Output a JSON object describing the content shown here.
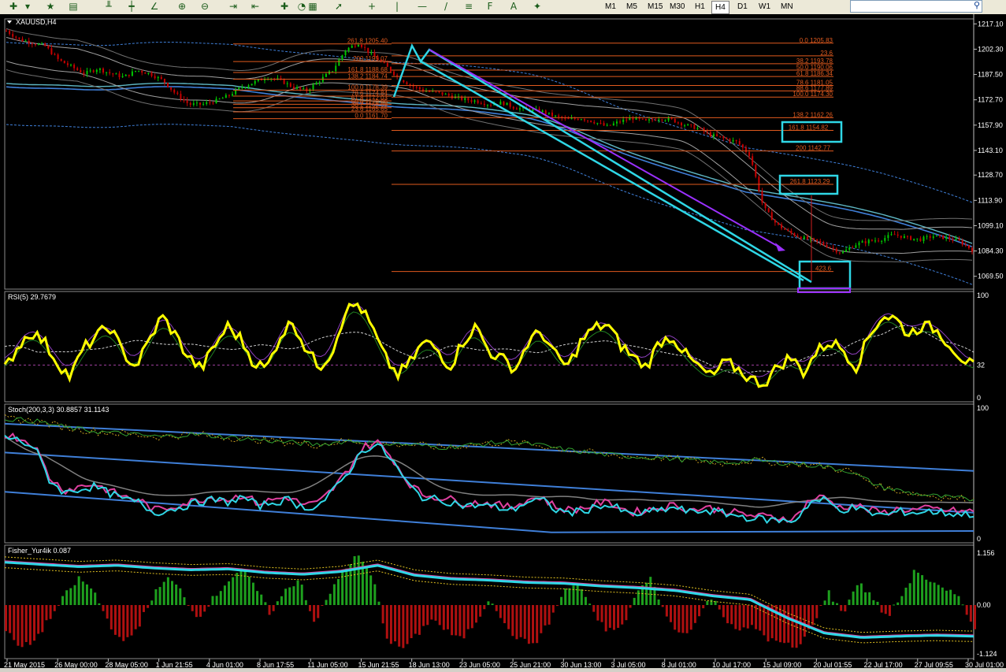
{
  "toolbar": {
    "timeframes": [
      "M1",
      "M5",
      "M15",
      "M30",
      "H1",
      "H4",
      "D1",
      "W1",
      "MN"
    ],
    "active_timeframe": "H4",
    "icons": [
      "new-chart-icon",
      "dropdown-icon",
      "favorites-star-icon",
      "profile-icon",
      "bar-chart-icon",
      "candlestick-icon",
      "line-chart-icon",
      "zoom-in-icon",
      "zoom-out-icon",
      "autoscroll-icon",
      "chart-shift-icon",
      "indicators-icon",
      "periods-icon",
      "templates-icon",
      "cursor-icon",
      "crosshair-icon",
      "vertical-line-icon",
      "horizontal-line-icon",
      "trendline-icon",
      "equidistant-channel-icon",
      "fibonacci-icon",
      "text-icon",
      "arrows-icon"
    ],
    "search_placeholder": ""
  },
  "colors": {
    "background": "#000000",
    "grid": "#c0c0c0",
    "candles_up": "#00c800",
    "candles_down": "#c80000",
    "fib": "#e05a1e",
    "cyan": "#2fd7e6",
    "purple": "#9b30ff",
    "rsi": "#ffff00",
    "blue_line": "#3f7fd8",
    "hist_up": "#1ea01e",
    "hist_down": "#b01010"
  },
  "chart_data": [
    {
      "type": "candlestick",
      "title": "XAUUSD,H4",
      "ylim": [
        1062,
        1220
      ],
      "y_ticks": [
        "1217.10",
        "1202.30",
        "1187.50",
        "1172.70",
        "1157.90",
        "1143.10",
        "1128.70",
        "1113.90",
        "1099.10",
        "1084.30",
        "1069.50"
      ],
      "x_labels": [
        "21 May 2015",
        "26 May 00:00",
        "28 May 05:00",
        "1 Jun 21:55",
        "4 Jun 01:00",
        "8 Jun 17:55",
        "11 Jun 05:00",
        "15 Jun 21:55",
        "18 Jun 13:00",
        "23 Jun 05:00",
        "25 Jun 21:00",
        "30 Jun 13:00",
        "3 Jul 05:00",
        "8 Jul 01:00",
        "10 Jul 17:00",
        "15 Jul 09:00",
        "20 Jul 01:55",
        "22 Jul 17:00",
        "27 Jul 09:55",
        "30 Jul 01:00"
      ],
      "close_path": [
        1213,
        1208,
        1206,
        1204,
        1196,
        1192,
        1188,
        1191,
        1188,
        1186,
        1190,
        1188,
        1184,
        1176,
        1170,
        1170,
        1172,
        1175,
        1180,
        1183,
        1186,
        1184,
        1180,
        1178,
        1184,
        1190,
        1202,
        1206,
        1199,
        1193,
        1186,
        1181,
        1178,
        1177,
        1175,
        1173,
        1172,
        1170,
        1171,
        1168,
        1167,
        1166,
        1163,
        1161,
        1162,
        1160,
        1157,
        1160,
        1162,
        1160,
        1162,
        1161,
        1158,
        1156,
        1152,
        1150,
        1148,
        1140,
        1110,
        1100,
        1095,
        1092,
        1090,
        1087,
        1083,
        1088,
        1090,
        1091,
        1094,
        1092,
        1091,
        1093,
        1092,
        1090,
        1085
      ],
      "fib_left": {
        "labels": [
          "261.8 1205.40",
          "200 1195.07",
          "161.8 1188.68",
          "138.2 1184.74",
          "100.0 1178.39",
          "78.6 1174.84",
          "61.8 1172.03",
          "50.0 1170.06",
          "38.2 1168.09",
          "23.6 1165.65",
          "0.0 1161.70"
        ],
        "prices": [
          1205.4,
          1195.07,
          1188.68,
          1184.74,
          1178.39,
          1174.84,
          1172.03,
          1170.06,
          1168.09,
          1165.65,
          1161.7
        ]
      },
      "fib_right": {
        "labels": [
          "0.0 1205.83",
          "23.6",
          "38.2 1193.78",
          "50.0 1190.06",
          "61.8 1186.34",
          "78.6 1181.05",
          "88.6 1177.89",
          "100.0 1174.30",
          "138.2 1162.26",
          "161.8 1154.82",
          "200 1142.77",
          "261.8 1123.29",
          "423.6"
        ],
        "prices": [
          1205.83,
          1198.4,
          1193.78,
          1190.06,
          1186.34,
          1181.05,
          1177.89,
          1174.3,
          1162.26,
          1154.82,
          1142.77,
          1123.29,
          1072.3
        ]
      }
    },
    {
      "type": "line",
      "title": "RSI(5) 29.7679",
      "ylim": [
        0,
        100
      ],
      "y_ticks": [
        "100",
        "32",
        "0"
      ],
      "level": 32,
      "values": [
        28,
        50,
        65,
        55,
        35,
        20,
        48,
        60,
        70,
        45,
        30,
        55,
        80,
        62,
        40,
        28,
        50,
        70,
        58,
        35,
        28,
        60,
        75,
        48,
        30,
        45,
        85,
        92,
        70,
        40,
        22,
        35,
        55,
        48,
        30,
        55,
        70,
        45,
        38,
        28,
        55,
        65,
        42,
        30,
        55,
        68,
        72,
        52,
        40,
        30,
        55,
        60,
        42,
        30,
        20,
        35,
        28,
        18,
        14,
        30,
        40,
        25,
        45,
        55,
        48,
        30,
        60,
        80,
        78,
        62,
        70,
        68,
        55,
        40,
        30
      ]
    },
    {
      "type": "line",
      "title": "Stoch(200,3,3) 30.8857 31.1143",
      "ylim": [
        0,
        100
      ],
      "y_ticks": [
        "100",
        "0"
      ],
      "values": [
        78,
        75,
        70,
        45,
        35,
        38,
        40,
        35,
        30,
        28,
        20,
        22,
        25,
        28,
        30,
        28,
        32,
        25,
        28,
        30,
        24,
        25,
        36,
        50,
        68,
        72,
        60,
        42,
        32,
        30,
        28,
        25,
        26,
        24,
        22,
        28,
        30,
        22,
        20,
        22,
        26,
        24,
        18,
        20,
        22,
        24,
        20,
        22,
        20,
        18,
        16,
        15,
        14,
        14,
        28,
        30,
        22,
        24,
        20,
        18,
        21,
        20,
        21,
        20,
        19,
        19
      ]
    },
    {
      "type": "bar",
      "title": "Fisher_Yur4ik 0.087",
      "ylim": [
        -1.124,
        1.156
      ],
      "y_ticks": [
        "1.156",
        "0.00",
        "-1.124"
      ],
      "values": [
        -0.6,
        -1.0,
        -0.8,
        -0.3,
        0.2,
        0.6,
        0.3,
        -0.4,
        -0.9,
        -0.5,
        0.2,
        0.6,
        0.3,
        -0.3,
        0.1,
        0.5,
        0.8,
        0.4,
        -0.2,
        0.3,
        0.6,
        -0.4,
        0.2,
        0.8,
        1.1,
        0.6,
        -0.8,
        -1.0,
        -0.7,
        -0.3,
        -0.6,
        -0.8,
        -0.4,
        0.2,
        -0.5,
        -0.8,
        -0.9,
        -0.4,
        0.3,
        0.5,
        -0.2,
        -0.6,
        -0.5,
        0.3,
        0.6,
        -0.3,
        -0.7,
        -0.4,
        0.2,
        -0.3,
        -0.6,
        -0.5,
        -0.8,
        -0.9,
        -1.0,
        -0.4,
        0.3,
        -0.2,
        0.5,
        0.2,
        -0.3,
        0.2,
        0.8,
        0.5,
        0.3,
        0.2,
        -0.6
      ]
    }
  ]
}
